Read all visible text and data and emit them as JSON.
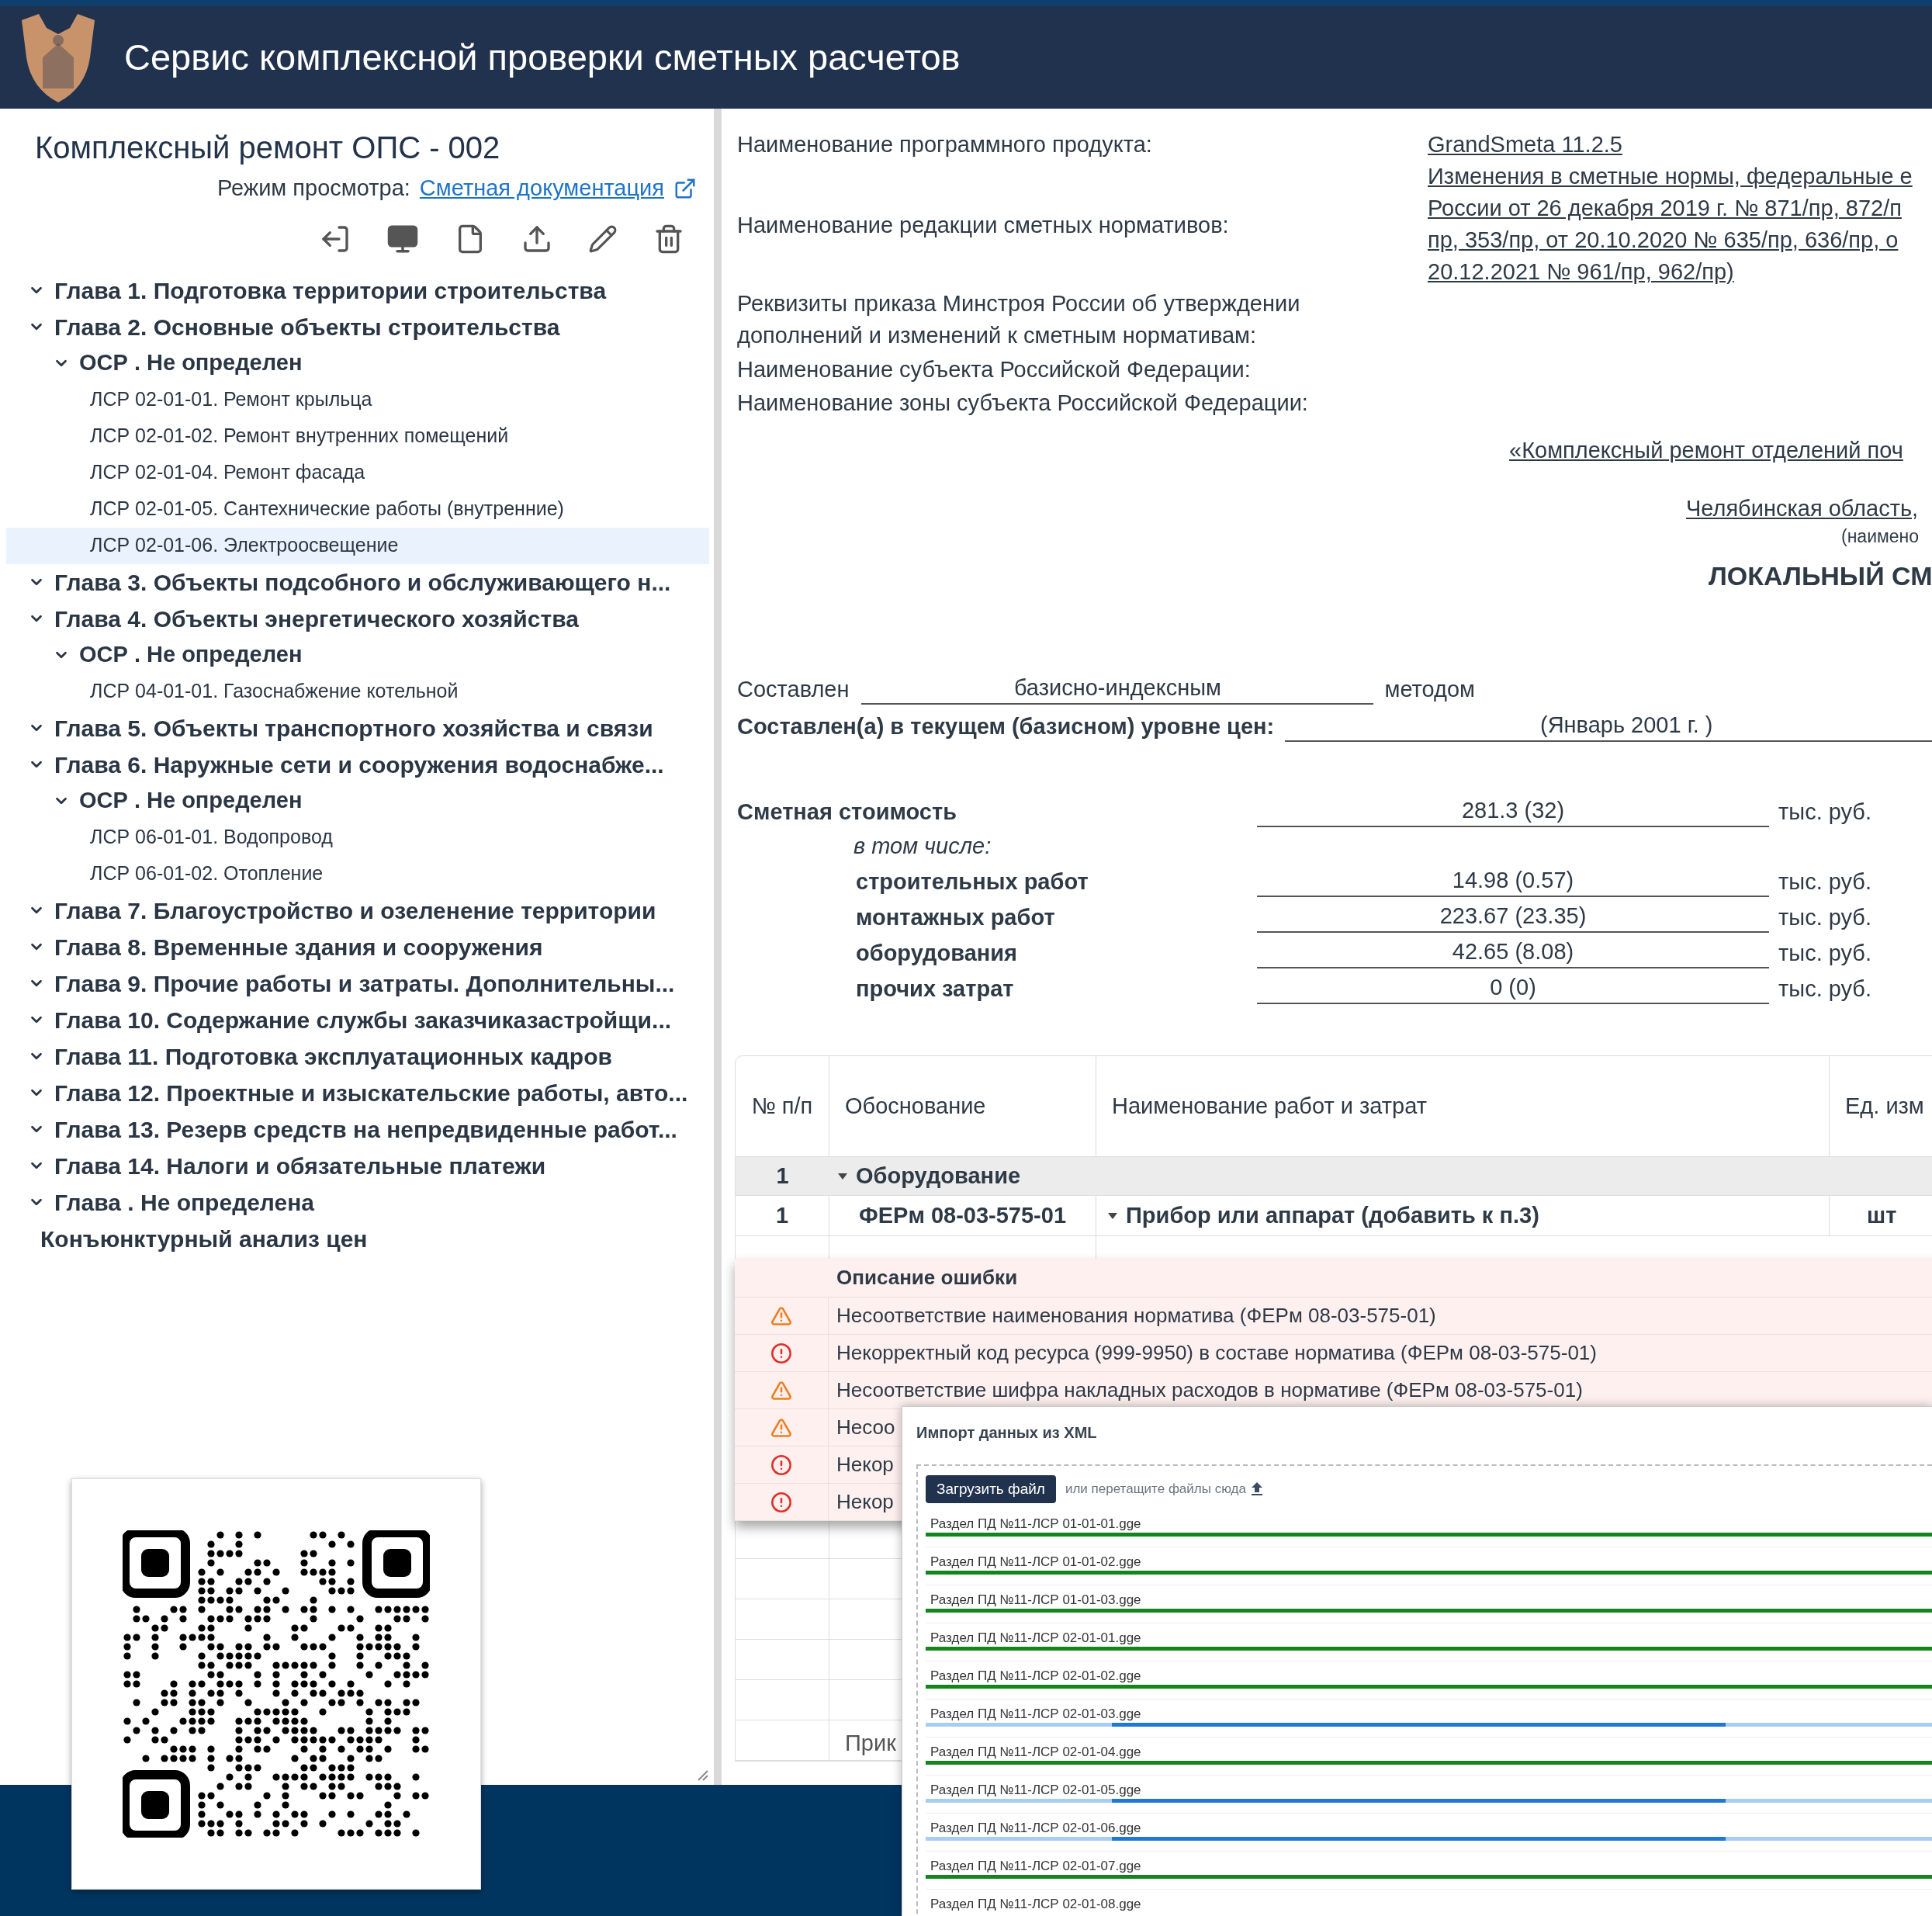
{
  "header": {
    "title": "Сервис комплексной проверки сметных расчетов"
  },
  "project": {
    "title": "Комплексный ремонт ОПС - 002",
    "mode_label": "Режим просмотра:",
    "mode_link": "Сметная документация"
  },
  "tree": [
    {
      "label": "Глава 1. Подготовка территории строительства",
      "expanded": true,
      "selected": false
    },
    {
      "label": "Глава 2. Основные объекты строительства",
      "expanded": true,
      "selected": false,
      "children": [
        {
          "label": "ОСР . Не определен",
          "expanded": true,
          "selected": false,
          "children": [
            {
              "label": "ЛСР 02-01-01. Ремонт крыльца",
              "selected": false
            },
            {
              "label": "ЛСР 02-01-02. Ремонт внутренних помещений",
              "selected": false
            },
            {
              "label": "ЛСР 02-01-04. Ремонт фасада",
              "selected": false
            },
            {
              "label": "ЛСР 02-01-05. Сантехнические работы (внутренние)",
              "selected": false
            },
            {
              "label": "ЛСР 02-01-06. Электроосвещение",
              "selected": true
            }
          ]
        }
      ]
    },
    {
      "label": "Глава 3. Объекты подсобного и обслуживающего н...",
      "expanded": true,
      "selected": false
    },
    {
      "label": "Глава 4. Объекты энергетического хозяйства",
      "expanded": true,
      "selected": false,
      "children": [
        {
          "label": "ОСР . Не определен",
          "expanded": true,
          "selected": false,
          "children": [
            {
              "label": "ЛСР 04-01-01. Газоснабжение котельной",
              "selected": false
            }
          ]
        }
      ]
    },
    {
      "label": "Глава 5. Объекты транспортного хозяйства и связи",
      "expanded": true,
      "selected": false
    },
    {
      "label": "Глава 6. Наружные сети и сооружения водоснабже...",
      "expanded": true,
      "selected": false,
      "children": [
        {
          "label": "ОСР . Не определен",
          "expanded": true,
          "selected": false,
          "children": [
            {
              "label": "ЛСР 06-01-01. Водопровод",
              "selected": false
            },
            {
              "label": "ЛСР 06-01-02. Отопление",
              "selected": false
            }
          ]
        }
      ]
    },
    {
      "label": "Глава 7. Благоустройство и озеленение территории",
      "expanded": true,
      "selected": false
    },
    {
      "label": "Глава 8. Временные здания и сооружения",
      "expanded": true,
      "selected": false
    },
    {
      "label": "Глава 9. Прочие работы и затраты. Дополнительны...",
      "expanded": true,
      "selected": false
    },
    {
      "label": "Глава 10. Содержание службы заказчиказастройщи...",
      "expanded": true,
      "selected": false
    },
    {
      "label": "Глава 11. Подготовка эксплуатационных кадров",
      "expanded": true,
      "selected": false
    },
    {
      "label": "Глава 12. Проектные и изыскательские работы, авто...",
      "expanded": true,
      "selected": false
    },
    {
      "label": "Глава 13. Резерв средств на непредвиденные работ...",
      "expanded": true,
      "selected": false
    },
    {
      "label": "Глава 14. Налоги и обязательные платежи",
      "expanded": true,
      "selected": false
    },
    {
      "label": "Глава . Не определена",
      "expanded": true,
      "selected": false
    },
    {
      "label": "Конъюнктурный анализ цен",
      "selected": false
    }
  ],
  "document": {
    "info_labels": [
      "Наименование программного продукта:",
      "Наименование редакции сметных нормативов:",
      "Реквизиты приказа Минстроя России об утверждении дополнений и изменений к сметным нормативам:",
      "Наименование субъекта Российской Федерации:",
      "Наименование зоны субъекта Российской Федерации:"
    ],
    "software": "GrandSmeta 11.2.5",
    "norms_edition_lines": [
      "Изменения в сметные нормы, федеральные е",
      "России от 26 декабря 2019 г. № 871/пр, 872/п",
      "пр, 353/пр, от 20.10.2020 № 635/пр, 636/пр, о",
      "20.12.2021 № 961/пр, 962/пр)"
    ],
    "object_name": "«Комплексный ремонт отделений поч",
    "region": "Челябинская область,",
    "region_caption": "(наимено",
    "doc_title": "ЛОКАЛЬНЫЙ СМ",
    "method": {
      "label": "Составлен",
      "value": "базисно-индексным",
      "suffix": "методом"
    },
    "price_level": {
      "label": "Составлен(а) в текущем (базисном) уровне цен:",
      "value": "(Январь 2001 г. )"
    },
    "cost": {
      "label": "Сметная стоимость",
      "value": "281.3 (32)",
      "unit": "тыс. руб.",
      "including": "в том числе:",
      "items": [
        {
          "label": "строительных работ",
          "value": "14.98 (0.57)",
          "unit": "тыс. руб."
        },
        {
          "label": "монтажных работ",
          "value": "223.67 (23.35)",
          "unit": "тыс. руб."
        },
        {
          "label": "оборудования",
          "value": "42.65 (8.08)",
          "unit": "тыс. руб."
        },
        {
          "label": "прочих затрат",
          "value": "0 (0)",
          "unit": "тыс. руб."
        }
      ]
    }
  },
  "table": {
    "columns": [
      "№ п/п",
      "Обоснование",
      "Наименование работ и затрат",
      "Ед. изм"
    ],
    "rows": [
      {
        "kind": "group",
        "number": "1",
        "name": "Оборудование",
        "expanded": true
      },
      {
        "kind": "item",
        "number": "1",
        "code": "ФЕРм 08-03-575-01",
        "name": "Прибор или аппарат (добавить к п.3)",
        "unit": "шт",
        "expanded": true
      }
    ],
    "trailing_cell": "Прик"
  },
  "errors": {
    "header": "Описание ошибки",
    "rows": [
      {
        "kind": "warning",
        "text": "Несоответствие наименования норматива (ФЕРм 08-03-575-01)"
      },
      {
        "kind": "error",
        "text": "Некорректный код ресурса (999-9950) в составе норматива (ФЕРм 08-03-575-01)"
      },
      {
        "kind": "warning",
        "text": "Несоответствие шифра накладных расходов в нормативе (ФЕРм 08-03-575-01)"
      },
      {
        "kind": "warning",
        "text": "Несоо"
      },
      {
        "kind": "error",
        "text": "Некор"
      },
      {
        "kind": "error",
        "text": "Некор"
      }
    ]
  },
  "import_dialog": {
    "title": "Импорт данных из XML",
    "button": "Загрузить файл",
    "hint": "или перетащите файлы сюда",
    "files": [
      {
        "name": "Раздел ПД №11-ЛСР 01-01-01.gge",
        "kind": "done"
      },
      {
        "name": "Раздел ПД №11-ЛСР 01-01-02.gge",
        "kind": "done"
      },
      {
        "name": "Раздел ПД №11-ЛСР 01-01-03.gge",
        "kind": "done"
      },
      {
        "name": "Раздел ПД №11-ЛСР 02-01-01.gge",
        "kind": "done"
      },
      {
        "name": "Раздел ПД №11-ЛСР 02-01-02.gge",
        "kind": "done"
      },
      {
        "name": "Раздел ПД №11-ЛСР 02-01-03.gge",
        "kind": "loading"
      },
      {
        "name": "Раздел ПД №11-ЛСР 02-01-04.gge",
        "kind": "done"
      },
      {
        "name": "Раздел ПД №11-ЛСР 02-01-05.gge",
        "kind": "loading"
      },
      {
        "name": "Раздел ПД №11-ЛСР 02-01-06.gge",
        "kind": "loading"
      },
      {
        "name": "Раздел ПД №11-ЛСР 02-01-07.gge",
        "kind": "done"
      },
      {
        "name": "Раздел ПД №11-ЛСР 02-01-08.gge"
      }
    ]
  }
}
